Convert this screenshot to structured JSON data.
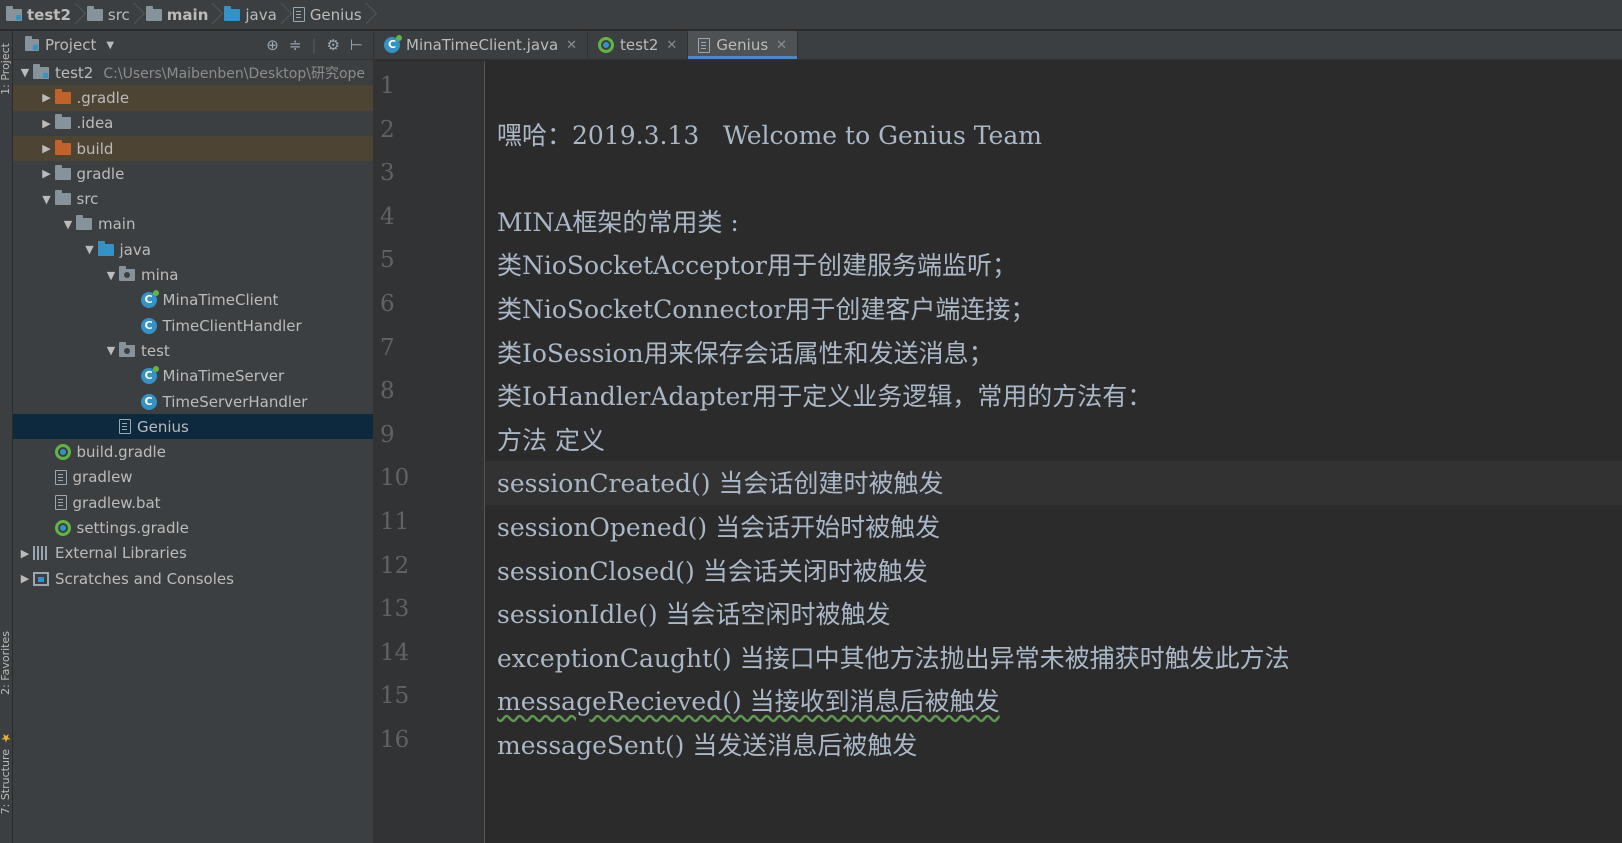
{
  "breadcrumb": [
    "test2",
    "src",
    "main",
    "java",
    "Genius"
  ],
  "left_strip": {
    "top_tab": "1: Project",
    "favorites_tab": "2: Favorites",
    "structure_tab": "7: Structure"
  },
  "project_panel": {
    "title": "Project",
    "tree": [
      {
        "label": "test2",
        "path": "C:\\Users\\Maibenben\\Desktop\\研究ope",
        "icon": "module-folder-icon",
        "indent": 0,
        "arrow": "down"
      },
      {
        "label": ".gradle",
        "icon": "orange-folder-icon",
        "indent": 1,
        "arrow": "right"
      },
      {
        "label": ".idea",
        "icon": "folder-icon",
        "indent": 1,
        "arrow": "right"
      },
      {
        "label": "build",
        "icon": "orange-folder-icon",
        "indent": 1,
        "arrow": "right"
      },
      {
        "label": "gradle",
        "icon": "folder-icon",
        "indent": 1,
        "arrow": "right"
      },
      {
        "label": "src",
        "icon": "folder-icon",
        "indent": 1,
        "arrow": "down"
      },
      {
        "label": "main",
        "icon": "folder-icon",
        "indent": 2,
        "arrow": "down"
      },
      {
        "label": "java",
        "icon": "source-folder-icon",
        "indent": 3,
        "arrow": "down"
      },
      {
        "label": "mina",
        "icon": "package-icon",
        "indent": 4,
        "arrow": "down"
      },
      {
        "label": "MinaTimeClient",
        "icon": "main-class-icon",
        "indent": 5,
        "arrow": ""
      },
      {
        "label": "TimeClientHandler",
        "icon": "class-icon",
        "indent": 5,
        "arrow": ""
      },
      {
        "label": "test",
        "icon": "package-icon",
        "indent": 4,
        "arrow": "down"
      },
      {
        "label": "MinaTimeServer",
        "icon": "main-class-icon",
        "indent": 5,
        "arrow": ""
      },
      {
        "label": "TimeServerHandler",
        "icon": "class-icon",
        "indent": 5,
        "arrow": ""
      },
      {
        "label": "Genius",
        "icon": "text-file-icon",
        "indent": 4,
        "arrow": ""
      },
      {
        "label": "build.gradle",
        "icon": "gradle-icon",
        "indent": 1,
        "arrow": ""
      },
      {
        "label": "gradlew",
        "icon": "text-file-icon",
        "indent": 1,
        "arrow": ""
      },
      {
        "label": "gradlew.bat",
        "icon": "text-file-icon",
        "indent": 1,
        "arrow": ""
      },
      {
        "label": "settings.gradle",
        "icon": "gradle-icon",
        "indent": 1,
        "arrow": ""
      },
      {
        "label": "External Libraries",
        "icon": "libraries-icon",
        "indent": 0,
        "arrow": "right"
      },
      {
        "label": "Scratches and Consoles",
        "icon": "scratches-icon",
        "indent": 0,
        "arrow": "right"
      }
    ]
  },
  "tabs": [
    {
      "label": "MinaTimeClient.java",
      "icon": "main-class-icon",
      "active": false
    },
    {
      "label": "test2",
      "icon": "gradle-icon",
      "active": false
    },
    {
      "label": "Genius",
      "icon": "text-file-icon",
      "active": true
    }
  ],
  "editor": {
    "current_line": 10,
    "lines": [
      "",
      "嘿哈：2019.3.13   Welcome to Genius Team",
      "",
      "MINA框架的常用类 :",
      "类NioSocketAcceptor用于创建服务端监听；",
      "类NioSocketConnector用于创建客户端连接；",
      "类IoSession用来保存会话属性和发送消息；",
      "类IoHandlerAdapter用于定义业务逻辑，常用的方法有：",
      "方法 定义",
      "sessionCreated() 当会话创建时被触发",
      "sessionOpened() 当会话开始时被触发",
      "sessionClosed() 当会话关闭时被触发",
      "sessionIdle() 当会话空闲时被触发",
      "exceptionCaught() 当接口中其他方法抛出异常未被捕获时触发此方法",
      "messageRecieved() 当接收到消息后被触发",
      "messageSent() 当发送消息后被触发"
    ]
  },
  "colors": {
    "selection": "#0d293e",
    "highlight": "#4d4433",
    "tab_underline": "#4a88c7",
    "text": "#a9b7c6"
  }
}
